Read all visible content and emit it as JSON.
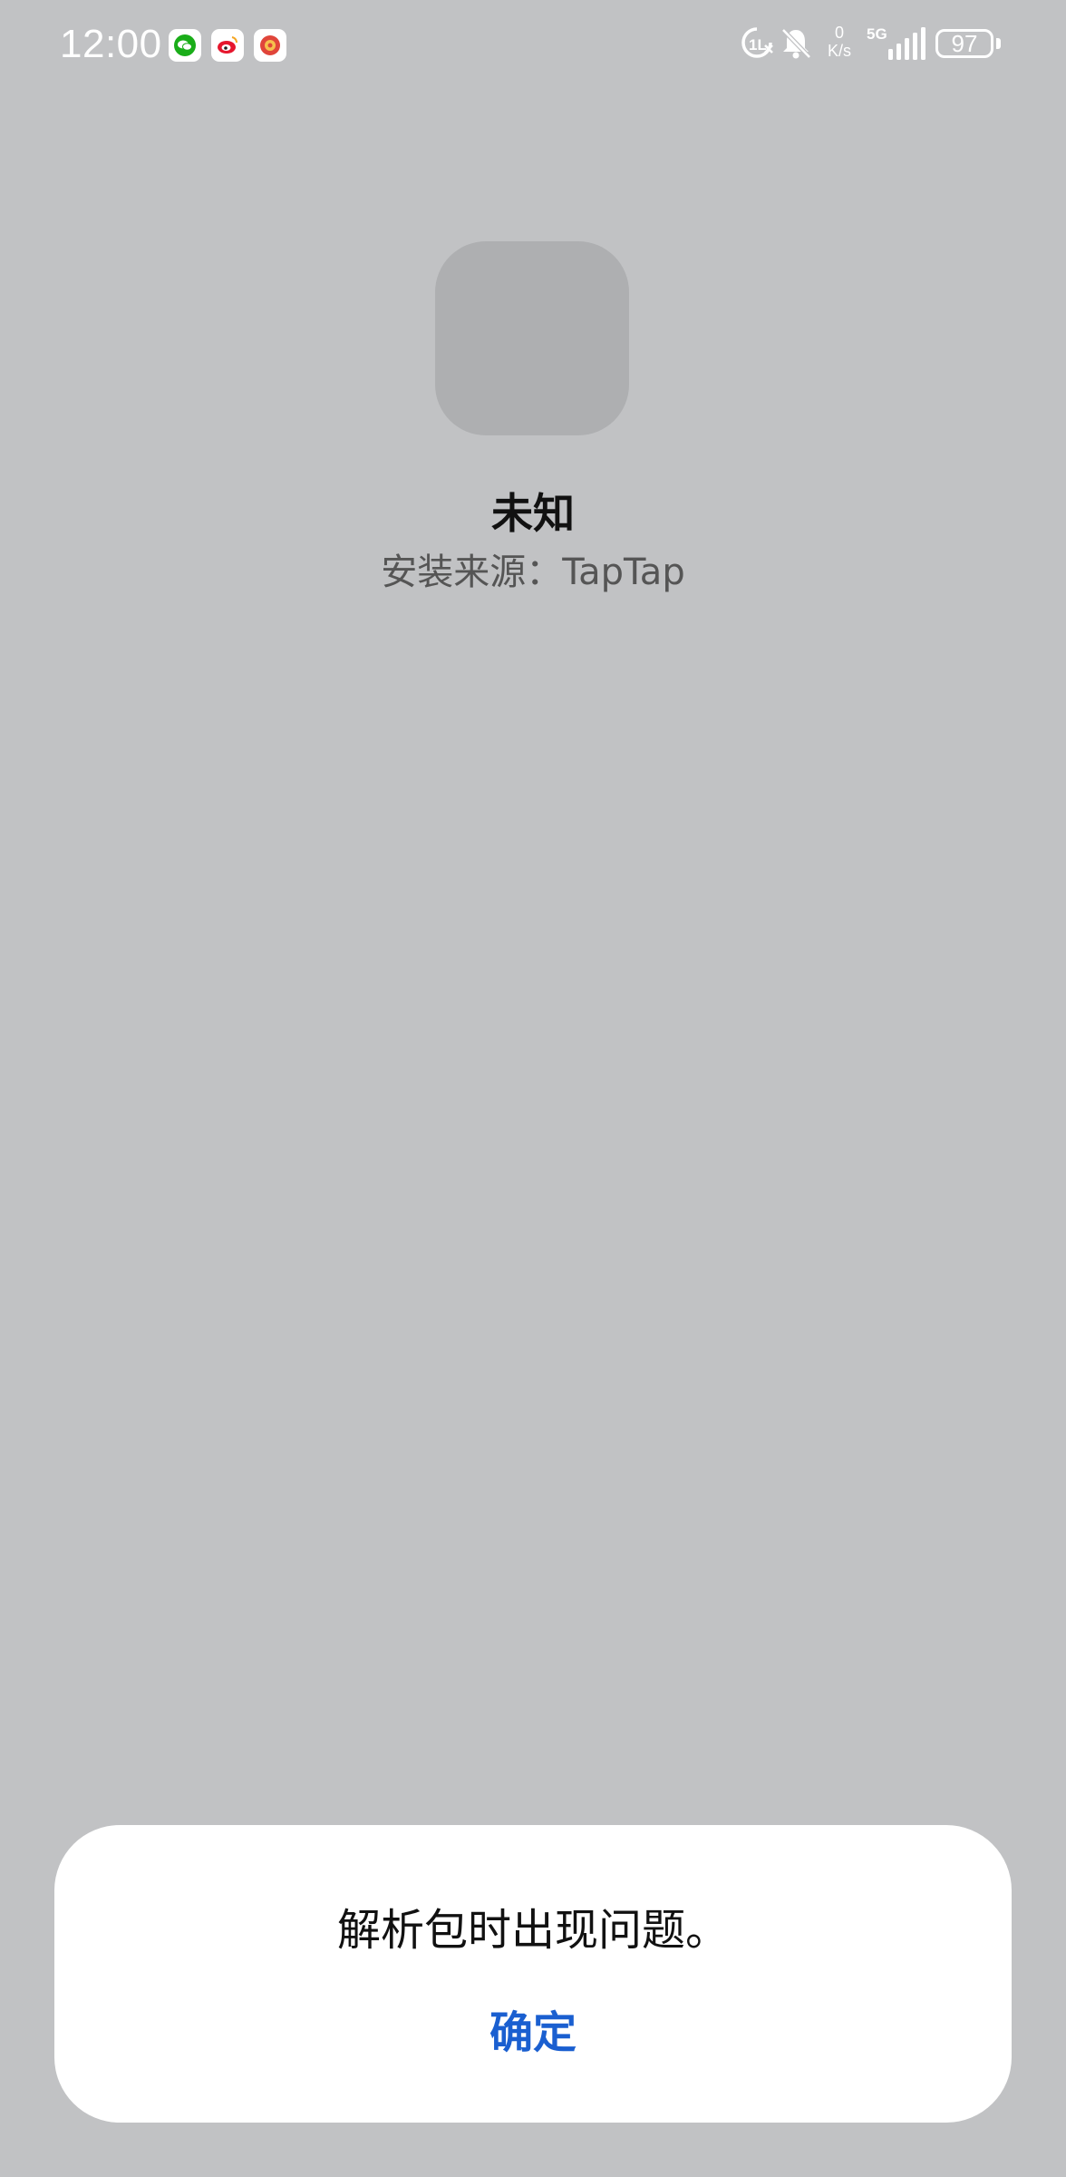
{
  "status_bar": {
    "time": "12:00",
    "notification_icons": [
      {
        "name": "wechat-icon",
        "color": "#1aad19"
      },
      {
        "name": "weibo-icon",
        "color": "#e6162d"
      },
      {
        "name": "app-notification-icon",
        "color": "#e0453a"
      }
    ],
    "net_speed_value": "0",
    "net_speed_unit": "K/s",
    "network_type": "5G",
    "battery_level": "97"
  },
  "app": {
    "name": "未知",
    "install_source": "安装来源：TapTap"
  },
  "dialog": {
    "message": "解析包时出现问题。",
    "confirm_label": "确定",
    "confirm_color": "#1a5fd0"
  }
}
